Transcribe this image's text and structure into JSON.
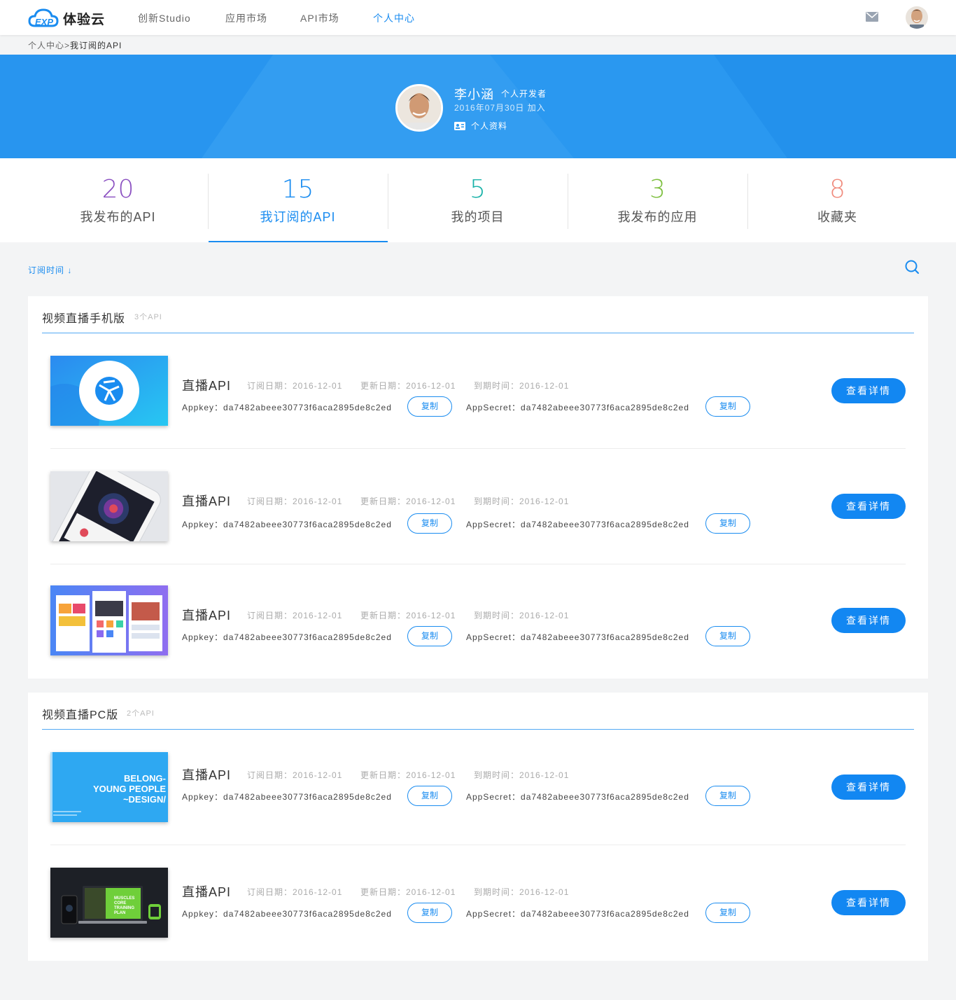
{
  "app": {
    "name": "体验云"
  },
  "nav": {
    "items": [
      {
        "label": "创新Studio"
      },
      {
        "label": "应用市场"
      },
      {
        "label": "API市场"
      },
      {
        "label": "个人中心"
      }
    ],
    "active": "个人中心"
  },
  "breadcrumb": {
    "parent": "个人中心",
    "separator": ">",
    "current": "我订阅的API"
  },
  "profile": {
    "name": "李小涵",
    "role": "个人开发者",
    "joined": "2016年07月30日  加入",
    "link": "个人资料"
  },
  "stats": [
    {
      "value": "20",
      "label": "我发布的API",
      "color": "#8a4fc1"
    },
    {
      "value": "15",
      "label": "我订阅的API",
      "color": "#1a8cf0"
    },
    {
      "value": "5",
      "label": "我的项目",
      "color": "#18b2a8"
    },
    {
      "value": "3",
      "label": "我发布的应用",
      "color": "#7cbf3d"
    },
    {
      "value": "8",
      "label": "收藏夹",
      "color": "#f08a7c"
    }
  ],
  "toolbar": {
    "sort_label": "订阅时间 ↓"
  },
  "common": {
    "api_name": "直播API",
    "sub_date": "订阅日期：2016-12-01",
    "upd_date": "更新日期：2016-12-01",
    "exp_date": "到期时间：2016-12-01",
    "appkey": "Appkey：da7482abeee30773f6aca2895de8c2ed",
    "appsecret": "AppSecret：da7482abeee30773f6aca2895de8c2ed",
    "copy": "复制",
    "detail": "查看详情"
  },
  "groups": [
    {
      "title": "视频直播手机版",
      "count": "3个API",
      "items": [
        {
          "thumb": "blue-ball"
        },
        {
          "thumb": "phone-astrolab"
        },
        {
          "thumb": "app-screens"
        }
      ]
    },
    {
      "title": "视频直播PC版",
      "count": "2个API",
      "items": [
        {
          "thumb": "belong-design",
          "thumb_text": [
            "BELONG-",
            "YOUNG PEOPLE",
            "~DESIGN/"
          ]
        },
        {
          "thumb": "muscles-devices",
          "thumb_text": [
            "MUSCLES",
            "CORE",
            "TRAINING",
            "PLAN"
          ]
        }
      ]
    }
  ],
  "colors": {
    "primary": "#1a8cf0",
    "banner": "#2a98f0"
  }
}
